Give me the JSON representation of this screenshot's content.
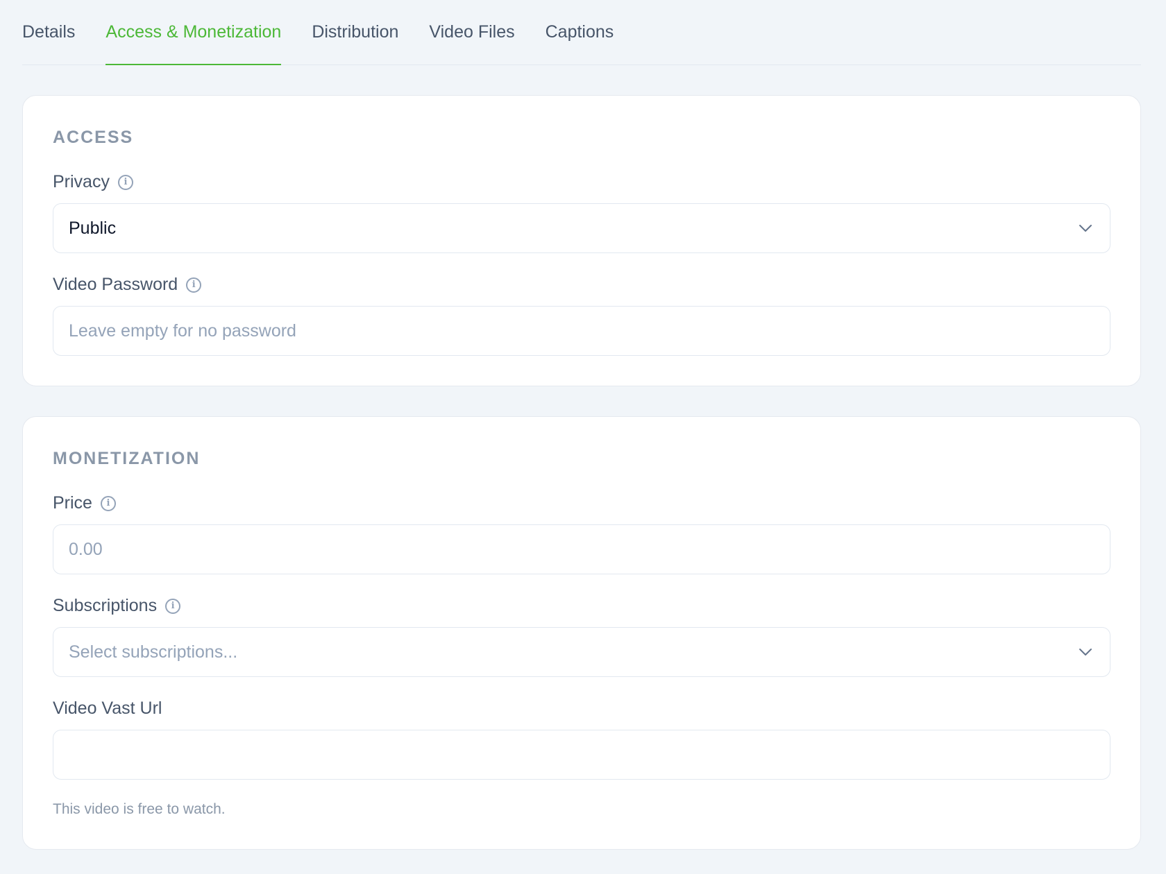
{
  "tabs": [
    {
      "label": "Details",
      "active": false
    },
    {
      "label": "Access & Monetization",
      "active": true
    },
    {
      "label": "Distribution",
      "active": false
    },
    {
      "label": "Video Files",
      "active": false
    },
    {
      "label": "Captions",
      "active": false
    }
  ],
  "access": {
    "title": "ACCESS",
    "privacy": {
      "label": "Privacy",
      "value": "Public"
    },
    "password": {
      "label": "Video Password",
      "placeholder": "Leave empty for no password",
      "value": ""
    }
  },
  "monetization": {
    "title": "MONETIZATION",
    "price": {
      "label": "Price",
      "placeholder": "0.00",
      "value": ""
    },
    "subscriptions": {
      "label": "Subscriptions",
      "placeholder": "Select subscriptions..."
    },
    "vast": {
      "label": "Video Vast Url",
      "value": ""
    },
    "helper": "This video is free to watch."
  },
  "colors": {
    "accent": "#4cb837",
    "background": "#f1f5f9",
    "card": "#ffffff"
  },
  "icons": {
    "info": "info-circle-icon",
    "chevron": "chevron-down-icon"
  }
}
